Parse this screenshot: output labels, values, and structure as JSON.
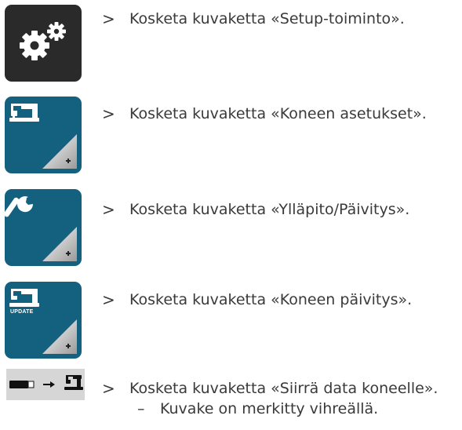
{
  "steps": [
    {
      "marker": ">",
      "text": "Kosketa kuvaketta «Setup-toiminto».",
      "icon": "setup-gears-icon"
    },
    {
      "marker": ">",
      "text": "Kosketa kuvaketta «Koneen asetukset».",
      "icon": "machine-settings-icon"
    },
    {
      "marker": ">",
      "text": "Kosketa kuvaketta «Ylläpito/Päivitys».",
      "icon": "wrench-icon"
    },
    {
      "marker": ">",
      "text": "Kosketa kuvaketta «Koneen päivitys».",
      "icon": "machine-update-icon",
      "icon_label": "UPDATE"
    },
    {
      "marker": ">",
      "text": "Kosketa kuvaketta «Siirrä data koneelle».",
      "icon": "transfer-data-icon",
      "sub": {
        "marker": "–",
        "text": "Kuvake on merkitty vihreällä."
      }
    }
  ],
  "colors": {
    "dark_tile": "#2a2a2a",
    "blue_tile": "#13607f",
    "text": "#3a3a3a"
  }
}
